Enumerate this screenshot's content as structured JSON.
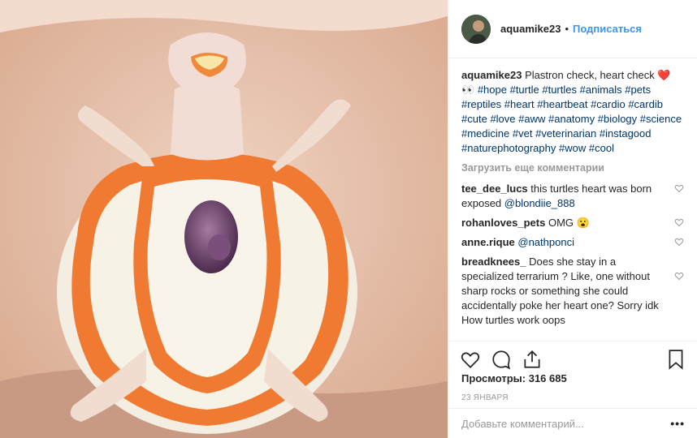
{
  "header": {
    "username": "aquamike23",
    "separator": "•",
    "follow_label": "Подписаться"
  },
  "caption": {
    "username": "aquamike23",
    "text": "Plastron check, heart check",
    "emoji_heart": "❤️",
    "emoji_eyes": "👀",
    "hashtags": [
      "#hope",
      "#turtle",
      "#turtles",
      "#animals",
      "#pets",
      "#reptiles",
      "#heart",
      "#heartbeat",
      "#cardio",
      "#cardib",
      "#cute",
      "#love",
      "#aww",
      "#anatomy",
      "#biology",
      "#science",
      "#medicine",
      "#vet",
      "#veterinarian",
      "#instagood",
      "#naturephotography",
      "#wow",
      "#cool"
    ]
  },
  "load_more_label": "Загрузить еще комментарии",
  "comments": [
    {
      "username": "tee_dee_lucs",
      "text": "this turtles heart was born exposed",
      "mention": "@blondiie_888"
    },
    {
      "username": "rohanloves_pets",
      "text": "OMG 😮",
      "mention": ""
    },
    {
      "username": "anne.rique",
      "text": "",
      "mention": "@nathponci"
    },
    {
      "username": "breadknees_",
      "text": "Does she stay in a specialized terrarium ? Like, one without sharp rocks or something she could accidentally poke her heart one? Sorry idk How turtles work oops",
      "mention": ""
    }
  ],
  "actions": {
    "like_icon": "heart-outline-icon",
    "comment_icon": "comment-bubble-icon",
    "share_icon": "share-icon",
    "save_icon": "bookmark-icon"
  },
  "views_label": "Просмотры:",
  "views_count": "316 685",
  "date": "23 ЯНВАРЯ",
  "add_comment_placeholder": "Добавьте комментарий...",
  "more_label": "•••",
  "colors": {
    "accent": "#3897f0",
    "hashtag": "#003569",
    "muted": "#999999"
  }
}
